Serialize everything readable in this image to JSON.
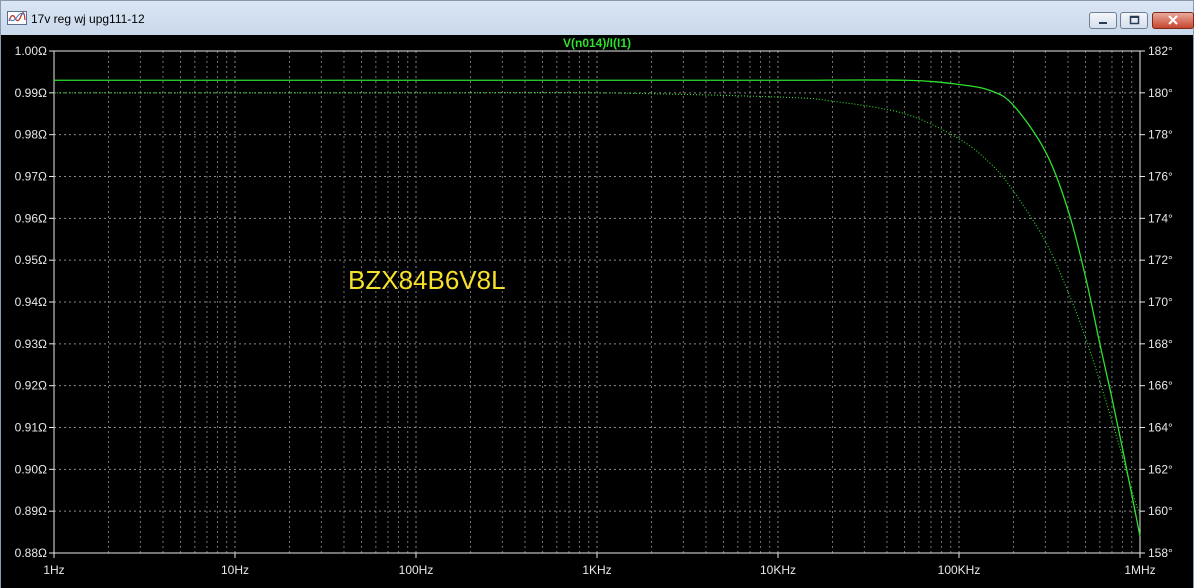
{
  "window": {
    "title": "17v reg wj upg111-12"
  },
  "icons": {
    "app": "waveform-icon",
    "minimize": "minimize-icon",
    "maximize": "maximize-icon",
    "close": "close-icon"
  },
  "colors": {
    "background": "#000000",
    "trace": "#2ee02e",
    "phase_trace": "#2ee02e",
    "grid": "#9a9a9a",
    "annotation": "#f5e02a",
    "labels": "#e8e8e8"
  },
  "chart_data": {
    "type": "line",
    "title": "V(n014)/I(I1)",
    "x_scale": "log",
    "xlim": [
      1,
      1000000
    ],
    "x_tick_labels": [
      "1Hz",
      "10Hz",
      "100Hz",
      "1KHz",
      "10KHz",
      "100KHz",
      "1MHz"
    ],
    "ylim": [
      0.88,
      1.0
    ],
    "y_tick_labels": [
      "1.00Ω",
      "0.99Ω",
      "0.98Ω",
      "0.97Ω",
      "0.96Ω",
      "0.95Ω",
      "0.94Ω",
      "0.93Ω",
      "0.92Ω",
      "0.91Ω",
      "0.90Ω",
      "0.89Ω",
      "0.88Ω"
    ],
    "y2lim": [
      158,
      182
    ],
    "y2_tick_labels": [
      "182°",
      "180°",
      "178°",
      "176°",
      "174°",
      "172°",
      "170°",
      "168°",
      "166°",
      "164°",
      "162°",
      "160°",
      "158°"
    ],
    "grid": true,
    "annotation": "BZX84B6V8L",
    "series": [
      {
        "style": "solid",
        "axis": "left",
        "x": [
          1,
          10,
          100,
          1000,
          10000,
          50000,
          100000,
          150000,
          200000,
          300000,
          400000,
          500000,
          600000,
          700000,
          800000,
          900000,
          1000000
        ],
        "y": [
          0.993,
          0.993,
          0.993,
          0.993,
          0.993,
          0.993,
          0.992,
          0.9905,
          0.987,
          0.976,
          0.962,
          0.946,
          0.93,
          0.917,
          0.905,
          0.894,
          0.884
        ]
      },
      {
        "style": "dotted",
        "axis": "right",
        "x": [
          1,
          10,
          100,
          1000,
          10000,
          20000,
          50000,
          100000,
          150000,
          200000,
          300000,
          400000,
          500000,
          600000,
          700000,
          800000,
          900000,
          1000000
        ],
        "y": [
          180.0,
          180.0,
          180.0,
          180.0,
          179.8,
          179.6,
          179.0,
          177.8,
          176.6,
          175.3,
          172.9,
          170.5,
          168.3,
          166.2,
          164.3,
          162.6,
          161.0,
          159.8
        ]
      }
    ]
  }
}
